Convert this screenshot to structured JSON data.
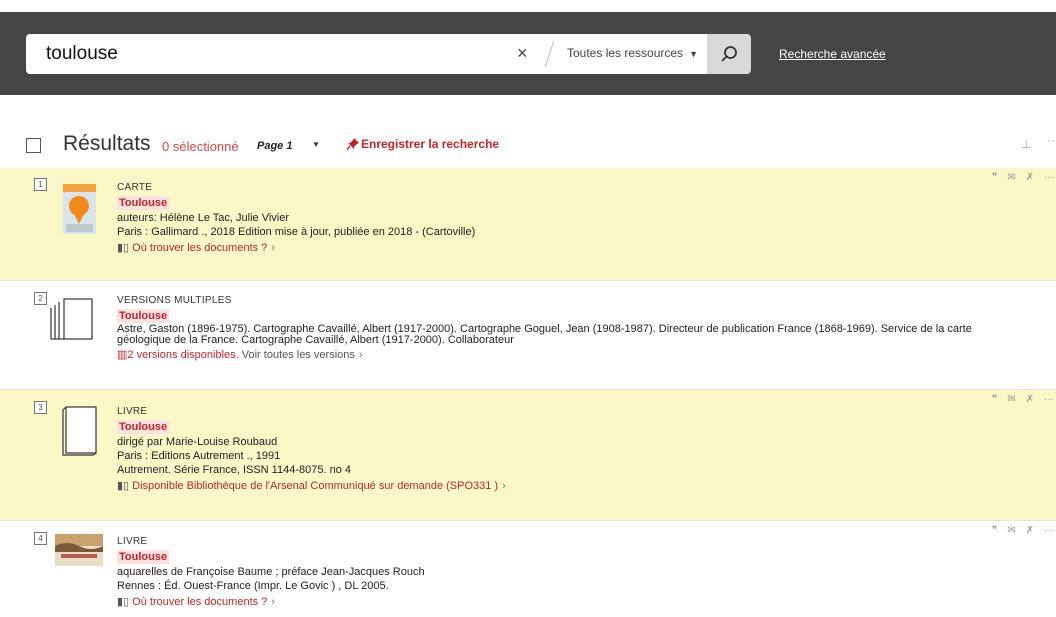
{
  "search": {
    "query": "toulouse",
    "clear": "×",
    "scope": "Toutes les ressources",
    "advanced": "Recherche avancée"
  },
  "header": {
    "title": "Résultats",
    "selected": "0 sélectionné",
    "page": "Page 1",
    "save": "Enregistrer la recherche"
  },
  "records": [
    {
      "num": "1",
      "type": "CARTE",
      "title": "Toulouse",
      "lines": [
        "auteurs: Hélène Le Tac, Julie Vivier",
        "Paris : Gallimard ., 2018 Edition mise à jour, publiée en 2018 - (Cartoville)"
      ],
      "link": "Où trouver les documents ?"
    },
    {
      "num": "2",
      "type": "VERSIONS MULTIPLES",
      "title": "Toulouse",
      "lines": [
        "Astre, Gaston (1896-1975). Cartographe Cavaillé, Albert (1917-2000). Cartographe Goguel, Jean (1908-1987). Directeur de publication France (1868-1969). Service de la carte",
        "géologique de la France. Cartographe Cavaillé, Albert (1917-2000). Collaborateur"
      ],
      "link": "2 versions disponibles.",
      "link_extra": "Voir toutes les versions"
    },
    {
      "num": "3",
      "type": "LIVRE",
      "title": "Toulouse",
      "lines": [
        "dirigé par Marie-Louise Roubaud",
        "Paris : Editions Autrement ., 1991",
        "Autrement. Série France, ISSN 1144-8075. no 4"
      ],
      "link": "Disponible Bibliothèque de l'Arsenal  Communiqué sur demande (SPO331 )"
    },
    {
      "num": "4",
      "type": "LIVRE",
      "title": "Toulouse",
      "lines": [
        "aquarelles de Françoise Baume ; préface Jean-Jacques Rouch",
        "Rennes : Éd. Ouest-France (Impr. Le Govic ) , DL 2005."
      ],
      "link": "Où trouver les documents ?"
    }
  ],
  "icons": {
    "quote": "quote-icon",
    "mail": "mail-icon",
    "pin": "pin-icon",
    "more": "more-icon"
  },
  "colors": {
    "accent": "#c0252a",
    "highlight": "#fbf8c7",
    "topbar": "#454545"
  }
}
